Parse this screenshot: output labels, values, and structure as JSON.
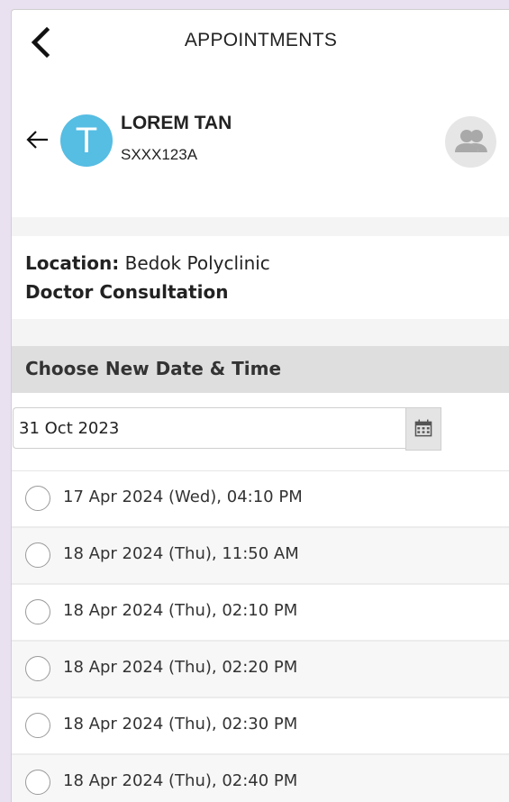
{
  "header": {
    "title": "APPOINTMENTS",
    "back_icon": "chevron-left-icon"
  },
  "patient": {
    "avatar_letter": "T",
    "name": "LOREM TAN",
    "id": "SXXX123A",
    "avatar_color": "#56bde3",
    "switch_icon": "people-icon"
  },
  "appointment": {
    "location_label": "Location:",
    "location_value": "Bedok Polyclinic",
    "service": "Doctor Consultation"
  },
  "reschedule": {
    "section_title": "Choose New Date & Time",
    "date_value": "31 Oct 2023",
    "calendar_icon": "calendar-icon"
  },
  "slots": [
    {
      "label": "17 Apr 2024 (Wed), 04:10 PM",
      "selected": false
    },
    {
      "label": "18 Apr 2024 (Thu), 11:50 AM",
      "selected": false
    },
    {
      "label": "18 Apr 2024 (Thu), 02:10 PM",
      "selected": false
    },
    {
      "label": "18 Apr 2024 (Thu), 02:20 PM",
      "selected": false
    },
    {
      "label": "18 Apr 2024 (Thu), 02:30 PM",
      "selected": false
    },
    {
      "label": "18 Apr 2024 (Thu), 02:40 PM",
      "selected": false
    }
  ]
}
